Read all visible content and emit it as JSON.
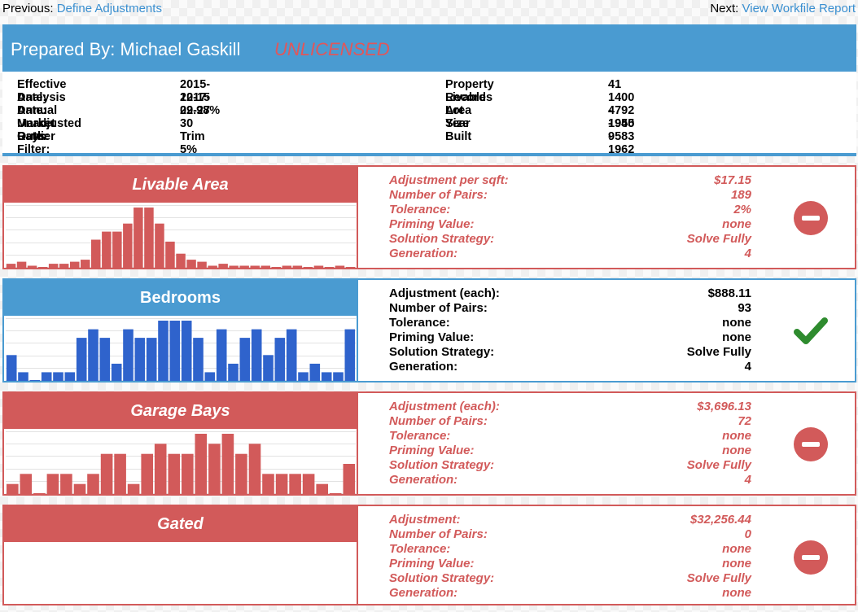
{
  "nav": {
    "prev_label": "Previous:",
    "prev_link": "Define Adjustments",
    "next_label": "Next:",
    "next_link": "View Workfile Report"
  },
  "header": {
    "prepared_by": "Prepared By: Michael Gaskill",
    "license_status": "UNLICENSED"
  },
  "summary": {
    "left": [
      {
        "label": "Effective Date:",
        "value": "2015-12-15"
      },
      {
        "label": "Analysis Date:",
        "value": "2017-02-27"
      },
      {
        "label": "Annual Market Rate:",
        "value": "29.98%"
      },
      {
        "label": "Unadjusted Days:",
        "value": "30"
      },
      {
        "label": "Outlier Filter:",
        "value": "Trim 5%"
      }
    ],
    "right": [
      {
        "label": "Property Records",
        "value": "41"
      },
      {
        "label": "Livable Area",
        "value": "1400 - 1945"
      },
      {
        "label": "Lot Size",
        "value": "4792 - 9583"
      },
      {
        "label": "Year Built",
        "value": "1950 - 1962"
      }
    ]
  },
  "colors": {
    "red": "#d25a5a",
    "blue": "#4a9bd1",
    "bar_blue": "#2f63cc",
    "check_green": "#2e8b2e"
  },
  "cards": [
    {
      "title": "Livable Area",
      "state": "rejected",
      "action_icon": "minus-circle-icon",
      "histogram": [
        2,
        3,
        1,
        0,
        2,
        2,
        3,
        4,
        14,
        18,
        18,
        22,
        30,
        30,
        22,
        13,
        7,
        4,
        3,
        1,
        2,
        1,
        1,
        1,
        1,
        0,
        1,
        1,
        0,
        1,
        0,
        1,
        0
      ],
      "details": [
        {
          "label": "Adjustment per sqft:",
          "value": "$17.15"
        },
        {
          "label": "Number of Pairs:",
          "value": "189"
        },
        {
          "label": "Tolerance:",
          "value": "2%"
        },
        {
          "label": "Priming Value:",
          "value": "none"
        },
        {
          "label": "Solution Strategy:",
          "value": "Solve Fully"
        },
        {
          "label": "Generation:",
          "value": "4"
        }
      ]
    },
    {
      "title": "Bedrooms",
      "state": "accepted",
      "action_icon": "checkmark-icon",
      "histogram": [
        3,
        1,
        0,
        1,
        1,
        1,
        5,
        6,
        5,
        2,
        6,
        5,
        5,
        7,
        7,
        7,
        5,
        1,
        6,
        2,
        5,
        6,
        3,
        5,
        6,
        1,
        2,
        1,
        1,
        6
      ],
      "details": [
        {
          "label": "Adjustment (each):",
          "value": "$888.11"
        },
        {
          "label": "Number of Pairs:",
          "value": "93"
        },
        {
          "label": "Tolerance:",
          "value": "none"
        },
        {
          "label": "Priming Value:",
          "value": "none"
        },
        {
          "label": "Solution Strategy:",
          "value": "Solve Fully"
        },
        {
          "label": "Generation:",
          "value": "4"
        }
      ]
    },
    {
      "title": "Garage Bays",
      "state": "rejected",
      "action_icon": "minus-circle-icon",
      "histogram": [
        1,
        2,
        0,
        2,
        2,
        1,
        2,
        4,
        4,
        1,
        4,
        5,
        4,
        4,
        6,
        5,
        6,
        4,
        5,
        2,
        2,
        2,
        2,
        1,
        0,
        3
      ],
      "details": [
        {
          "label": "Adjustment (each):",
          "value": "$3,696.13"
        },
        {
          "label": "Number of Pairs:",
          "value": "72"
        },
        {
          "label": "Tolerance:",
          "value": "none"
        },
        {
          "label": "Priming Value:",
          "value": "none"
        },
        {
          "label": "Solution Strategy:",
          "value": "Solve Fully"
        },
        {
          "label": "Generation:",
          "value": "4"
        }
      ]
    },
    {
      "title": "Gated",
      "state": "rejected",
      "action_icon": "minus-circle-icon",
      "histogram": [],
      "details": [
        {
          "label": "Adjustment:",
          "value": "$32,256.44"
        },
        {
          "label": "Number of Pairs:",
          "value": "0"
        },
        {
          "label": "Tolerance:",
          "value": "none"
        },
        {
          "label": "Priming Value:",
          "value": "none"
        },
        {
          "label": "Solution Strategy:",
          "value": "Solve Fully"
        },
        {
          "label": "Generation:",
          "value": "none"
        }
      ]
    }
  ]
}
